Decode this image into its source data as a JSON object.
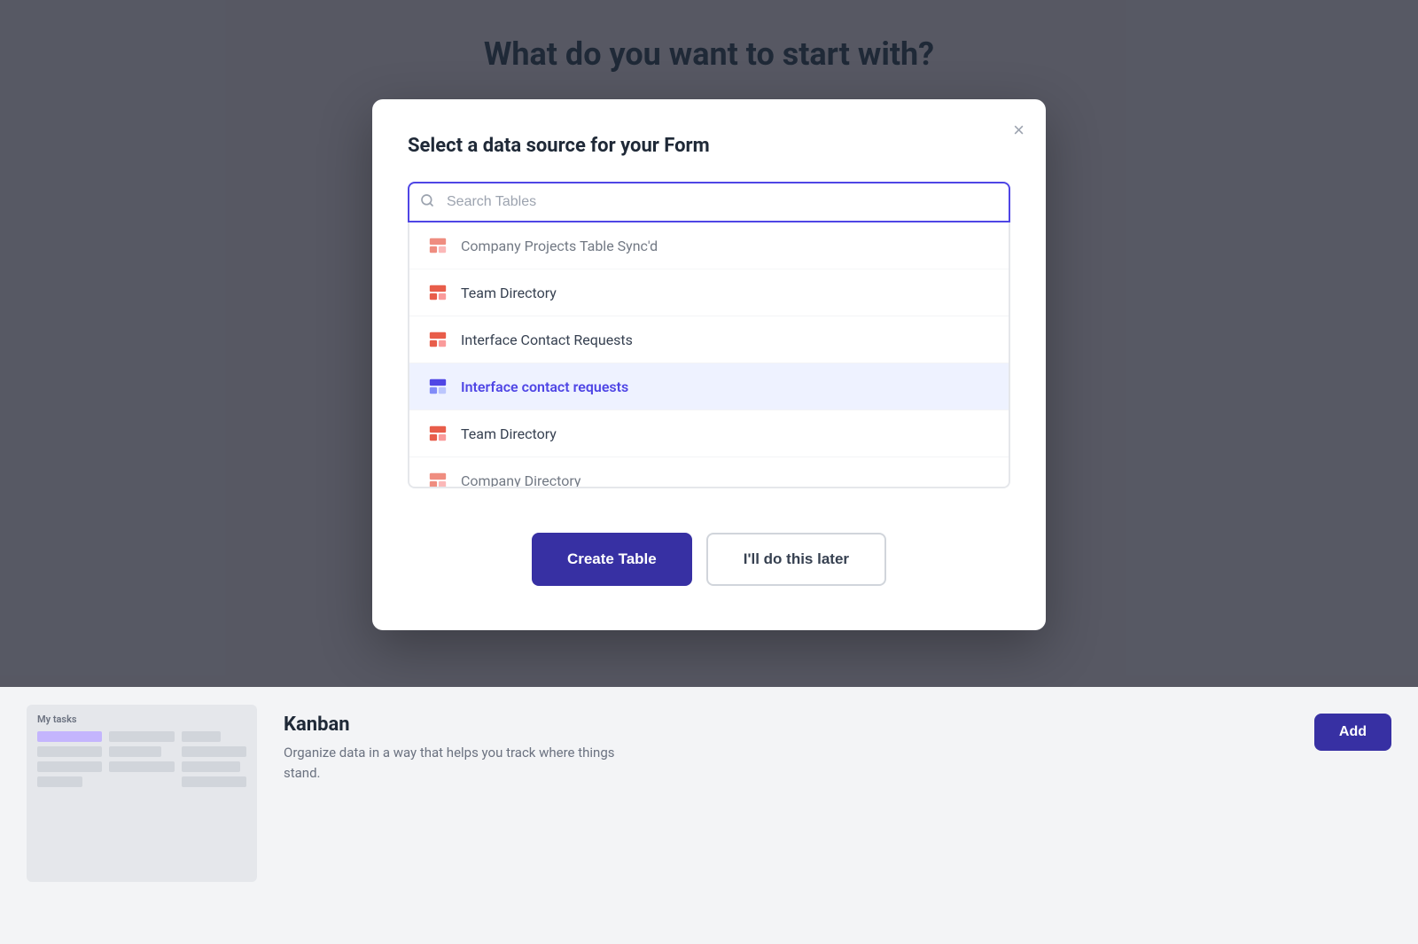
{
  "page": {
    "title": "What do you want to start with?",
    "bg_color": "#6b7280"
  },
  "modal": {
    "title": "Select a data source for your Form",
    "close_label": "×",
    "search_placeholder": "Search Tables",
    "table_items": [
      {
        "id": 0,
        "name": "Company Projects Table Sync'd",
        "partial": true,
        "selected": false
      },
      {
        "id": 1,
        "name": "Team Directory",
        "partial": false,
        "selected": false
      },
      {
        "id": 2,
        "name": "Interface Contact Requests",
        "partial": false,
        "selected": false
      },
      {
        "id": 3,
        "name": "Interface contact requests",
        "partial": false,
        "selected": true
      },
      {
        "id": 4,
        "name": "Team Directory",
        "partial": false,
        "selected": false
      },
      {
        "id": 5,
        "name": "Company Directory",
        "partial": true,
        "selected": false
      }
    ],
    "create_button": "Create Table",
    "later_button": "I'll do this later"
  },
  "bottom": {
    "kanban_label": "My tasks",
    "kanban_title": "Kanban",
    "kanban_desc": "Organize data in a way that helps you track where things stand.",
    "add_button": "Add"
  },
  "icons": {
    "search": "🔍",
    "close": "✕",
    "airtable": "⊞"
  }
}
